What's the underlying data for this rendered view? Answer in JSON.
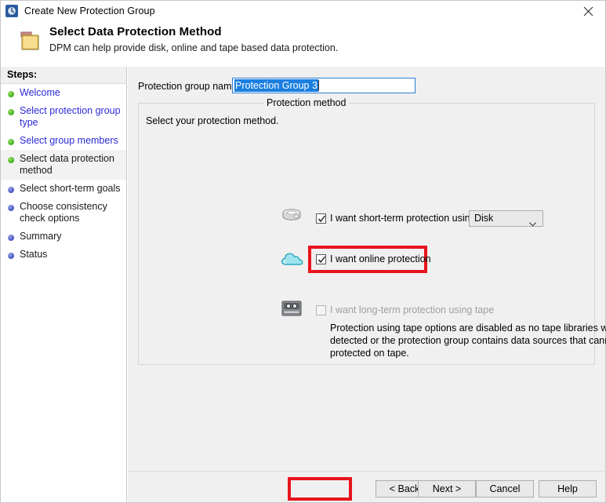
{
  "window": {
    "title": "Create New Protection Group",
    "title_icon": "clock-icon",
    "close_icon": "close-icon"
  },
  "header": {
    "icon": "folder-icon",
    "title": "Select Data Protection Method",
    "subtitle": "DPM can help provide disk, online and tape based data protection."
  },
  "sidebar": {
    "header": "Steps:",
    "items": [
      {
        "label": "Welcome",
        "state": "done",
        "current": false
      },
      {
        "label": "Select protection group type",
        "state": "done",
        "current": false
      },
      {
        "label": "Select group members",
        "state": "done",
        "current": false
      },
      {
        "label": "Select data protection method",
        "state": "done",
        "current": true
      },
      {
        "label": "Select short-term goals",
        "state": "todo",
        "current": false
      },
      {
        "label": "Choose consistency check options",
        "state": "todo",
        "current": false
      },
      {
        "label": "Summary",
        "state": "todo",
        "current": false
      },
      {
        "label": "Status",
        "state": "todo",
        "current": false
      }
    ]
  },
  "main": {
    "protection_group_name_label": "Protection group name:",
    "protection_group_name_value": "Protection Group 3",
    "groupbox_legend": "Protection method",
    "instruction": "Select your protection method.",
    "options": {
      "short_term": {
        "icon": "disk-drive-icon",
        "label": "I want short-term protection using:",
        "checked": true,
        "enabled": true,
        "dropdown_value": "Disk",
        "dropdown_icon": "chevron-down-icon"
      },
      "online": {
        "icon": "cloud-icon",
        "label": "I want online protection",
        "checked": true,
        "enabled": true,
        "highlighted": true
      },
      "long_term": {
        "icon": "tape-cartridge-icon",
        "label": "I want long-term protection using tape",
        "checked": false,
        "enabled": false,
        "note": "Protection using tape options are disabled as no tape libraries were detected or the protection group contains data sources that cannot be protected on tape."
      }
    }
  },
  "buttons": {
    "back": "< Back",
    "next": "Next >",
    "cancel": "Cancel",
    "help": "Help"
  },
  "colors": {
    "highlight_red": "#e8131c",
    "link_blue": "#2b2bd6",
    "selection_blue": "#1a7fe0",
    "step_done": "#3fae1e",
    "step_todo": "#4a54c2"
  }
}
